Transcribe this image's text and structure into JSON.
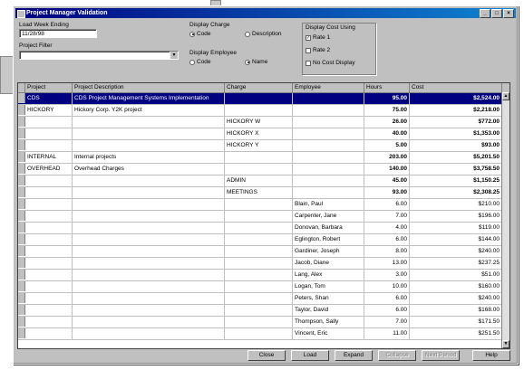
{
  "window": {
    "title": "Project Manager Validation"
  },
  "filters": {
    "load_week_label": "Load Week Ending",
    "load_week_value": "11/28/98",
    "project_filter_label": "Project Filter",
    "project_filter_value": "",
    "display_charge_label": "Display Charge",
    "charge_code": "Code",
    "charge_description": "Description",
    "display_employee_label": "Display Employee",
    "employee_code": "Code",
    "employee_name": "Name",
    "display_cost_label": "Display Cost Using",
    "rate1": "Rate 1",
    "rate2": "Rate 2",
    "no_cost": "No Cost Display"
  },
  "grid": {
    "columns": [
      "Project",
      "Project Description",
      "Charge",
      "Employee",
      "Hours",
      "Cost"
    ],
    "rows": [
      {
        "project": "CDS",
        "desc": "CDS Project Management Systems Implementation",
        "charge": "",
        "employee": "",
        "hours": "95.00",
        "cost": "$2,524.00",
        "bold": true,
        "selected": true
      },
      {
        "project": "HICKORY",
        "desc": "Hickory Corp. Y2K project",
        "charge": "",
        "employee": "",
        "hours": "75.00",
        "cost": "$2,218.00",
        "bold": true
      },
      {
        "project": "",
        "desc": "",
        "charge": "HICKORY W",
        "employee": "",
        "hours": "26.00",
        "cost": "$772.00",
        "bold": true
      },
      {
        "project": "",
        "desc": "",
        "charge": "HICKORY X",
        "employee": "",
        "hours": "40.00",
        "cost": "$1,353.00",
        "bold": true
      },
      {
        "project": "",
        "desc": "",
        "charge": "HICKORY Y",
        "employee": "",
        "hours": "5.00",
        "cost": "$93.00",
        "bold": true
      },
      {
        "project": "INTERNAL",
        "desc": "Internal projects",
        "charge": "",
        "employee": "",
        "hours": "203.00",
        "cost": "$5,201.50",
        "bold": true
      },
      {
        "project": "OVERHEAD",
        "desc": "Overhead Charges",
        "charge": "",
        "employee": "",
        "hours": "140.00",
        "cost": "$3,758.50",
        "bold": true
      },
      {
        "project": "",
        "desc": "",
        "charge": "ADMIN",
        "employee": "",
        "hours": "45.00",
        "cost": "$1,150.25",
        "bold": true
      },
      {
        "project": "",
        "desc": "",
        "charge": "MEETINGS",
        "employee": "",
        "hours": "93.00",
        "cost": "$2,308.25",
        "bold": true
      },
      {
        "project": "",
        "desc": "",
        "charge": "",
        "employee": "Blain, Paul",
        "hours": "6.00",
        "cost": "$210.00"
      },
      {
        "project": "",
        "desc": "",
        "charge": "",
        "employee": "Carpenter, Jane",
        "hours": "7.00",
        "cost": "$196.00"
      },
      {
        "project": "",
        "desc": "",
        "charge": "",
        "employee": "Donovan, Barbara",
        "hours": "4.00",
        "cost": "$119.00"
      },
      {
        "project": "",
        "desc": "",
        "charge": "",
        "employee": "Eglington, Robert",
        "hours": "6.00",
        "cost": "$144.00"
      },
      {
        "project": "",
        "desc": "",
        "charge": "",
        "employee": "Gardiner, Joseph",
        "hours": "8.00",
        "cost": "$240.00"
      },
      {
        "project": "",
        "desc": "",
        "charge": "",
        "employee": "Jacob, Diane",
        "hours": "13.00",
        "cost": "$237.25"
      },
      {
        "project": "",
        "desc": "",
        "charge": "",
        "employee": "Lang, Alex",
        "hours": "3.00",
        "cost": "$51.00"
      },
      {
        "project": "",
        "desc": "",
        "charge": "",
        "employee": "Logan, Tom",
        "hours": "10.00",
        "cost": "$160.00"
      },
      {
        "project": "",
        "desc": "",
        "charge": "",
        "employee": "Peters, Shan",
        "hours": "6.00",
        "cost": "$240.00"
      },
      {
        "project": "",
        "desc": "",
        "charge": "",
        "employee": "Taylor, David",
        "hours": "6.00",
        "cost": "$168.00"
      },
      {
        "project": "",
        "desc": "",
        "charge": "",
        "employee": "Thompson, Sally",
        "hours": "7.00",
        "cost": "$171.50"
      },
      {
        "project": "",
        "desc": "",
        "charge": "",
        "employee": "Vincent, Eric",
        "hours": "11.00",
        "cost": "$251.50"
      }
    ]
  },
  "buttons": {
    "close": "Close",
    "load": "Load",
    "expand": "Expand",
    "collapse": "Collapse",
    "next_period": "Next Period",
    "help": "Help"
  }
}
